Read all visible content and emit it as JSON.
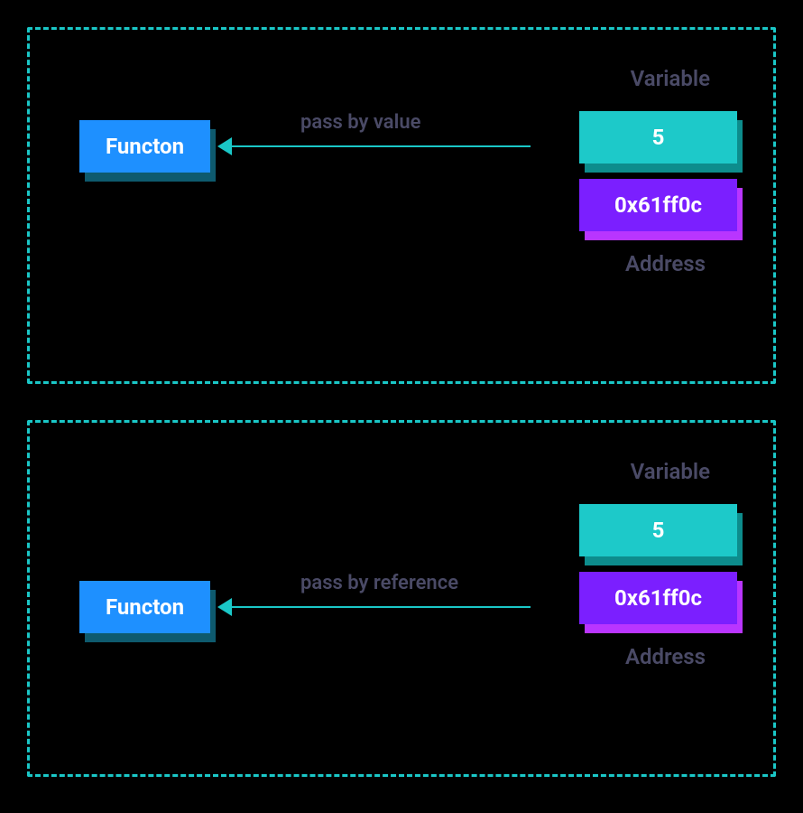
{
  "panel1": {
    "function_label": "Functon",
    "arrow_label": "pass by value",
    "variable_label": "Variable",
    "value_text": "5",
    "address_text": "0x61ff0c",
    "address_label": "Address"
  },
  "panel2": {
    "function_label": "Functon",
    "arrow_label": "pass by reference",
    "variable_label": "Variable",
    "value_text": "5",
    "address_text": "0x61ff0c",
    "address_label": "Address"
  },
  "colors": {
    "border": "#1ac7c7",
    "function_bg": "#1e90ff",
    "value_bg": "#1dc9c9",
    "address_bg": "#7b1fff",
    "text_muted": "#4a4a66"
  }
}
